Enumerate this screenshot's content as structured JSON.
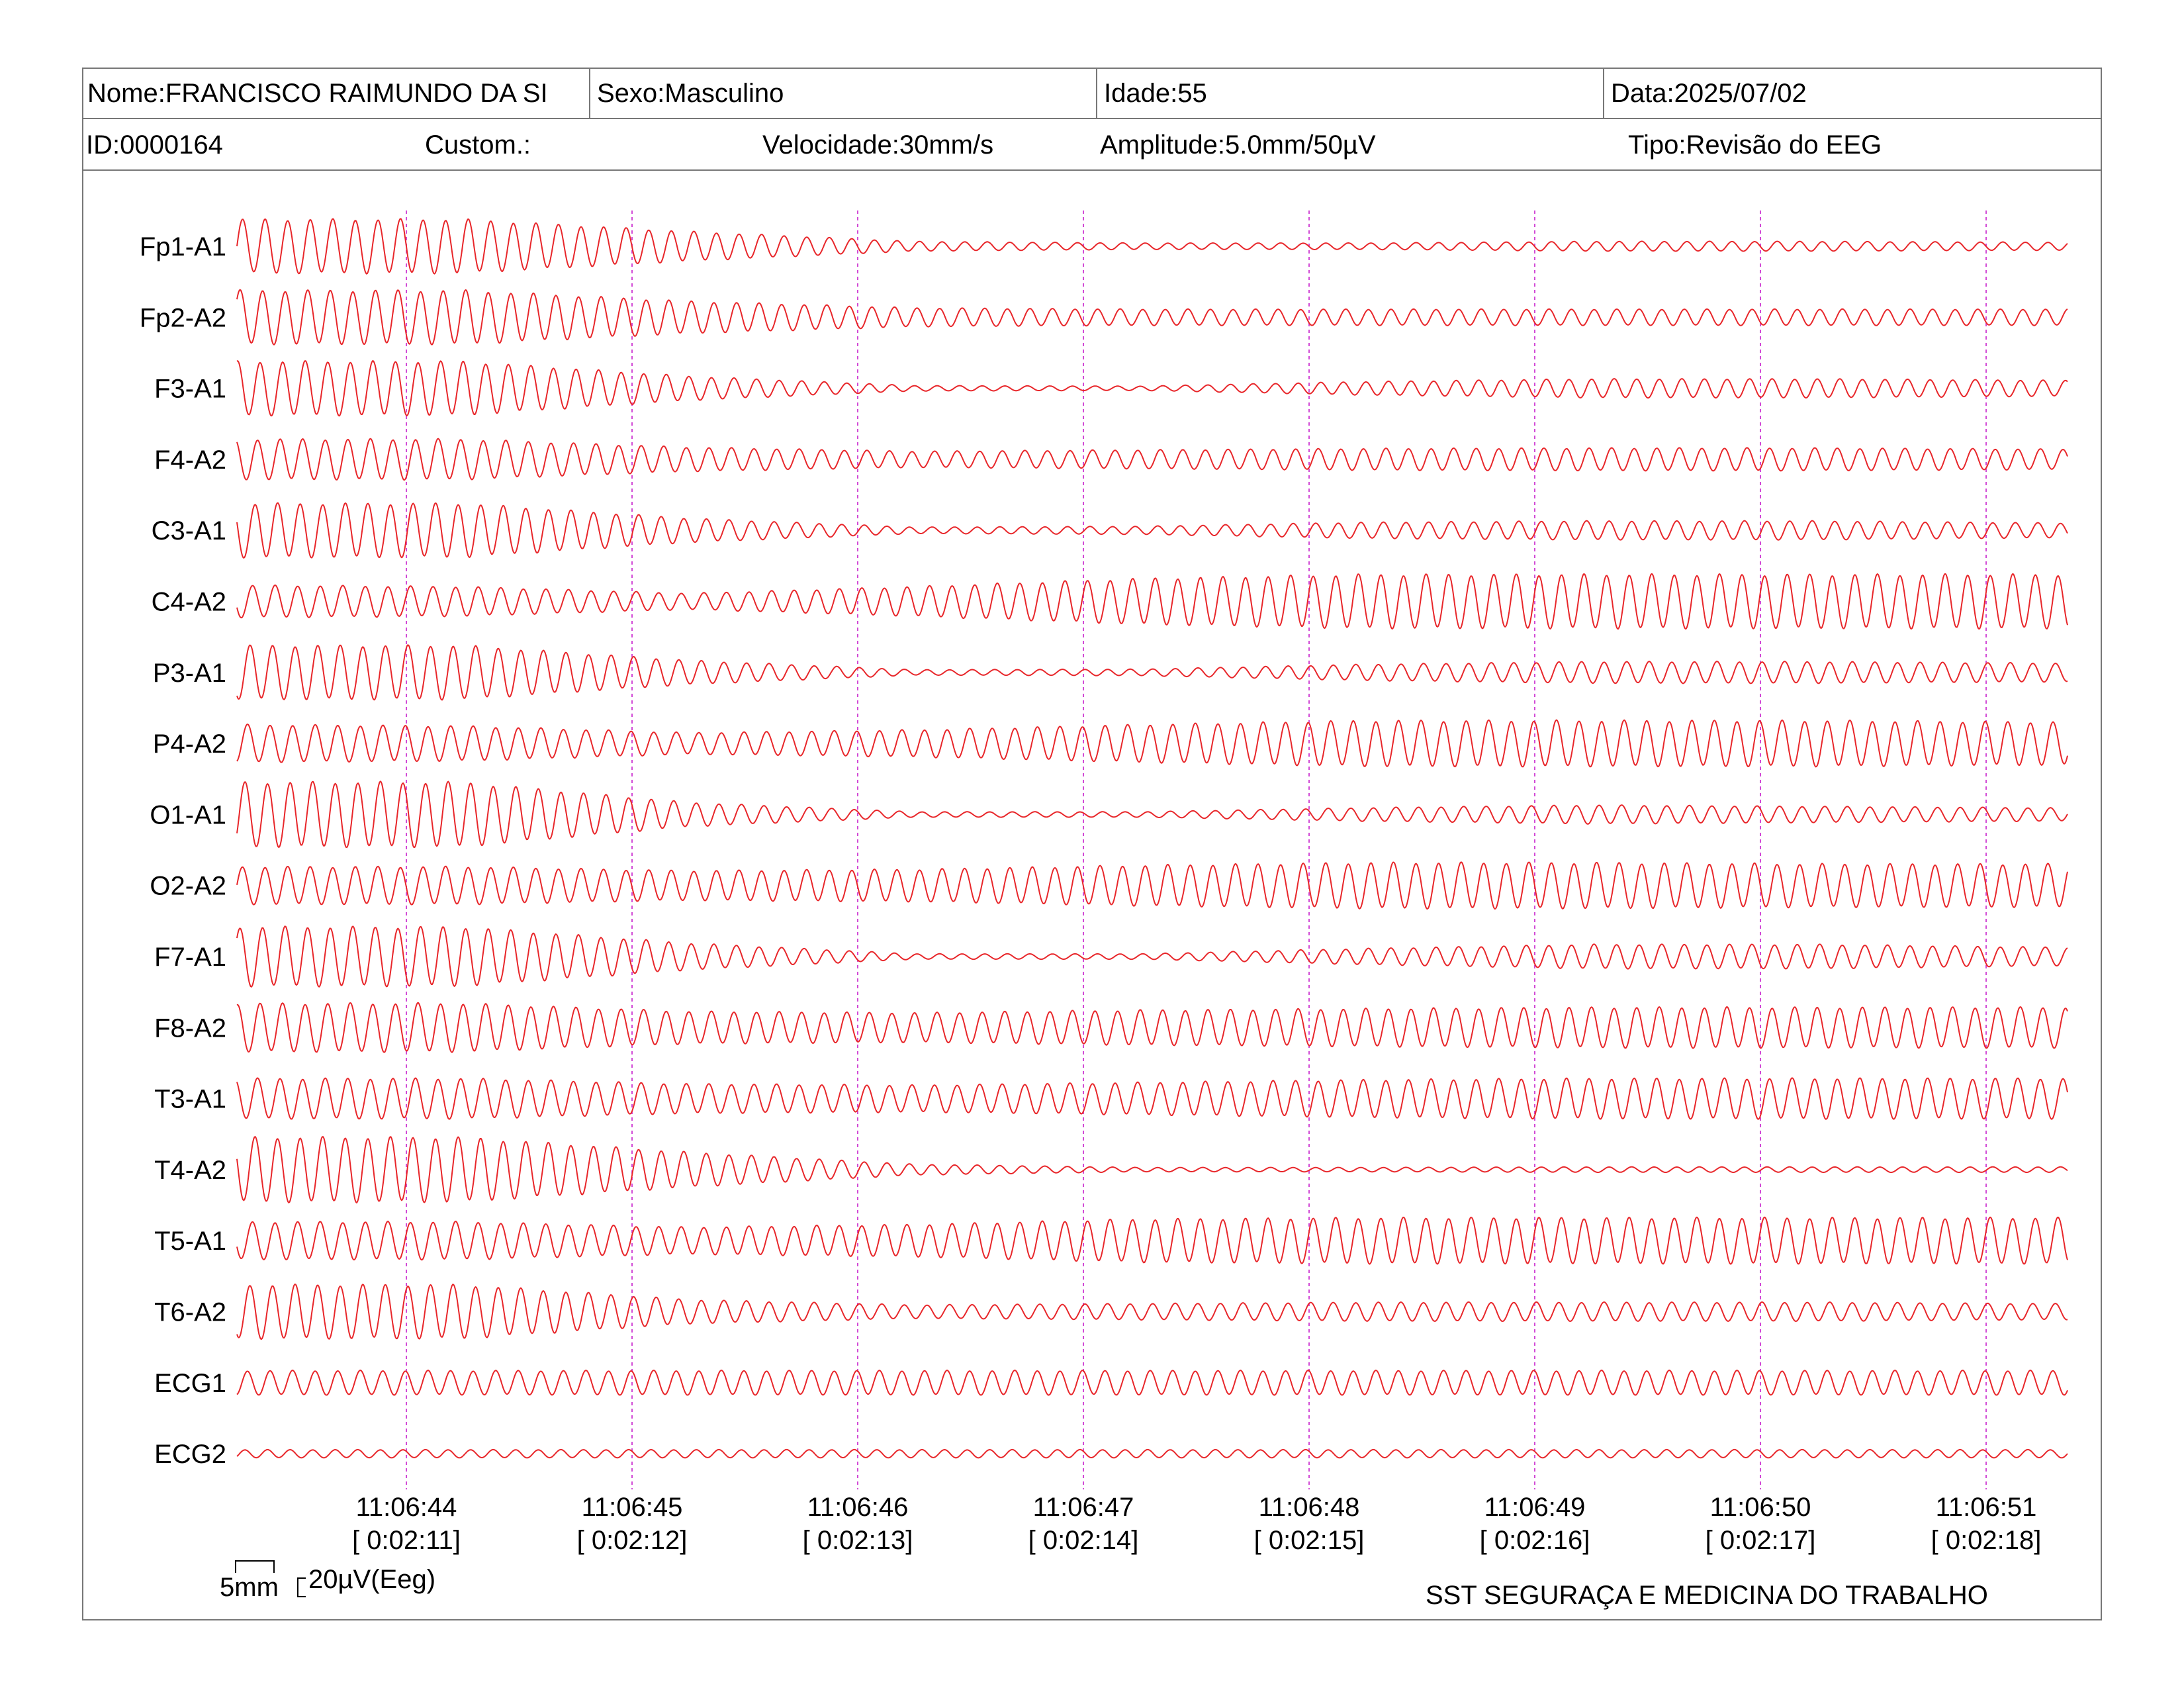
{
  "header": {
    "nome": "Nome:FRANCISCO RAIMUNDO DA SI",
    "sexo": "Sexo:Masculino",
    "idade": "Idade:55",
    "data": "Data:2025/07/02",
    "id": "ID:0000164",
    "custom": "Custom.:",
    "velocidade": "Velocidade:30mm/s",
    "amplitude": "Amplitude:5.0mm/50µV",
    "tipo": "Tipo:Revisão do EEG"
  },
  "scale": {
    "time_label": "5mm",
    "amp_label": "20µV(Eeg)"
  },
  "footer": {
    "company": "SST SEGURAÇA E MEDICINA DO TRABALHO"
  },
  "colors": {
    "trace": "#e8262a",
    "gridline": "#d24bd6",
    "border": "#777777"
  },
  "chart_data": {
    "type": "line",
    "title": "",
    "channels": [
      "Fp1-A1",
      "Fp2-A2",
      "F3-A1",
      "F4-A2",
      "C3-A1",
      "C4-A2",
      "P3-A1",
      "P4-A2",
      "O1-A1",
      "O2-A2",
      "F7-A1",
      "F8-A2",
      "T3-A1",
      "T4-A2",
      "T5-A1",
      "T6-A2",
      "ECG1",
      "ECG2"
    ],
    "x_ticks": [
      {
        "time": "11:06:44",
        "elapsed": "[ 0:02:11]"
      },
      {
        "time": "11:06:45",
        "elapsed": "[ 0:02:12]"
      },
      {
        "time": "11:06:46",
        "elapsed": "[ 0:02:13]"
      },
      {
        "time": "11:06:47",
        "elapsed": "[ 0:02:14]"
      },
      {
        "time": "11:06:48",
        "elapsed": "[ 0:02:15]"
      },
      {
        "time": "11:06:49",
        "elapsed": "[ 0:02:16]"
      },
      {
        "time": "11:06:50",
        "elapsed": "[ 0:02:17]"
      },
      {
        "time": "11:06:51",
        "elapsed": "[ 0:02:18]"
      }
    ],
    "frequency_hz": 10,
    "amplitude_profile_x": [
      0,
      1,
      2,
      3,
      4,
      5,
      6,
      7,
      8,
      9
    ],
    "series": [
      {
        "name": "Fp1-A1",
        "amplitude_relative": [
          1.0,
          1.0,
          0.55,
          0.18,
          0.12,
          0.12,
          0.18,
          0.18,
          0.15,
          0.15
        ]
      },
      {
        "name": "Fp2-A2",
        "amplitude_relative": [
          1.0,
          1.0,
          0.6,
          0.35,
          0.3,
          0.3,
          0.3,
          0.3,
          0.3,
          0.3
        ]
      },
      {
        "name": "F3-A1",
        "amplitude_relative": [
          1.0,
          1.0,
          0.45,
          0.1,
          0.08,
          0.25,
          0.35,
          0.35,
          0.3,
          0.2
        ]
      },
      {
        "name": "F4-A2",
        "amplitude_relative": [
          0.75,
          0.75,
          0.45,
          0.3,
          0.35,
          0.4,
          0.42,
          0.42,
          0.38,
          0.35
        ]
      },
      {
        "name": "C3-A1",
        "amplitude_relative": [
          1.0,
          1.0,
          0.45,
          0.12,
          0.15,
          0.3,
          0.35,
          0.35,
          0.28,
          0.2
        ]
      },
      {
        "name": "C4-A2",
        "amplitude_relative": [
          0.6,
          0.55,
          0.3,
          0.55,
          0.85,
          1.0,
          1.0,
          1.0,
          1.0,
          1.0
        ]
      },
      {
        "name": "P3-A1",
        "amplitude_relative": [
          1.0,
          1.0,
          0.45,
          0.1,
          0.12,
          0.3,
          0.4,
          0.4,
          0.35,
          0.3
        ]
      },
      {
        "name": "P4-A2",
        "amplitude_relative": [
          0.7,
          0.65,
          0.4,
          0.5,
          0.7,
          0.85,
          0.85,
          0.85,
          0.8,
          0.8
        ]
      },
      {
        "name": "O1-A1",
        "amplitude_relative": [
          1.2,
          1.2,
          0.45,
          0.1,
          0.1,
          0.25,
          0.35,
          0.3,
          0.25,
          0.15
        ]
      },
      {
        "name": "O2-A2",
        "amplitude_relative": [
          0.7,
          0.7,
          0.55,
          0.6,
          0.75,
          0.85,
          0.85,
          0.8,
          0.8,
          0.8
        ]
      },
      {
        "name": "F7-A1",
        "amplitude_relative": [
          1.1,
          1.1,
          0.5,
          0.1,
          0.1,
          0.3,
          0.45,
          0.45,
          0.35,
          0.25
        ]
      },
      {
        "name": "F8-A2",
        "amplitude_relative": [
          0.9,
          0.9,
          0.6,
          0.55,
          0.65,
          0.7,
          0.75,
          0.75,
          0.75,
          0.75
        ]
      },
      {
        "name": "T3-A1",
        "amplitude_relative": [
          0.75,
          0.75,
          0.55,
          0.5,
          0.6,
          0.7,
          0.75,
          0.75,
          0.75,
          0.75
        ]
      },
      {
        "name": "T4-A2",
        "amplitude_relative": [
          1.2,
          1.2,
          0.65,
          0.2,
          0.08,
          0.08,
          0.1,
          0.1,
          0.1,
          0.1
        ]
      },
      {
        "name": "T5-A1",
        "amplitude_relative": [
          0.7,
          0.7,
          0.5,
          0.6,
          0.8,
          0.85,
          0.85,
          0.85,
          0.85,
          0.85
        ]
      },
      {
        "name": "T6-A2",
        "amplitude_relative": [
          1.0,
          1.0,
          0.45,
          0.25,
          0.3,
          0.35,
          0.35,
          0.35,
          0.3,
          0.3
        ]
      },
      {
        "name": "ECG1",
        "amplitude_relative": [
          0.45,
          0.45,
          0.45,
          0.45,
          0.45,
          0.45,
          0.45,
          0.45,
          0.45,
          0.45
        ]
      },
      {
        "name": "ECG2",
        "amplitude_relative": [
          0.15,
          0.15,
          0.15,
          0.15,
          0.15,
          0.15,
          0.15,
          0.15,
          0.15,
          0.15
        ]
      }
    ]
  }
}
